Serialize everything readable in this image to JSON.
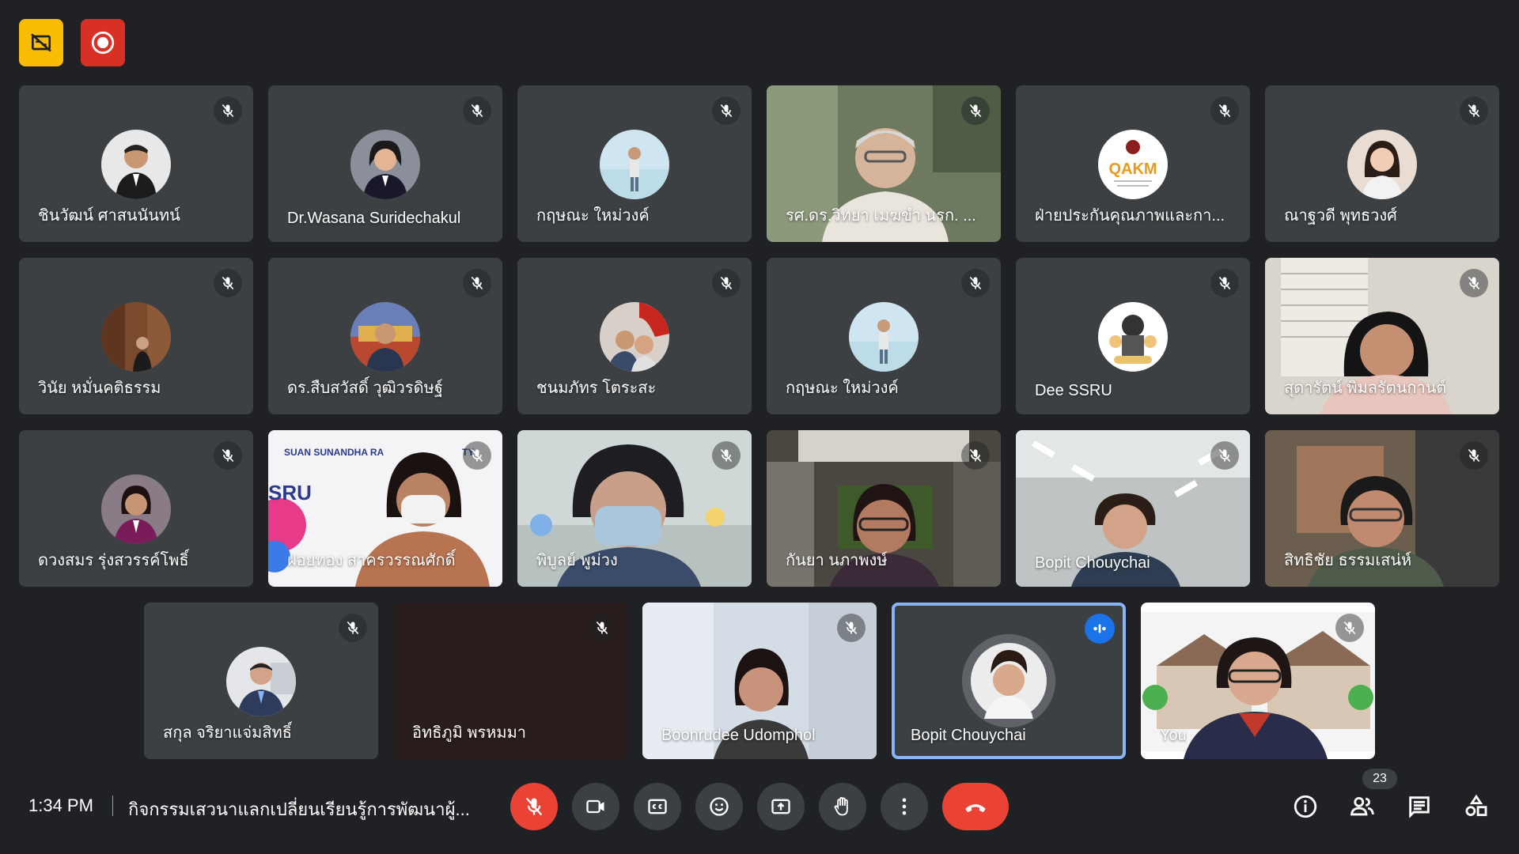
{
  "top_badges": {
    "captions_off_icon": "no-captions-icon",
    "record_icon": "recording-icon"
  },
  "participants": [
    {
      "name": "ชินวัฒน์ ศาสนนันทน์"
    },
    {
      "name": "Dr.Wasana Suridechakul"
    },
    {
      "name": "กฤษณะ ใหม่วงค์"
    },
    {
      "name": "รศ.ดร.วิทยา เมฆขำ นรก. ..."
    },
    {
      "name": "ฝ่ายประกันคุณภาพและกา..."
    },
    {
      "name": "ณาฐวดี พุทธวงศ์"
    },
    {
      "name": "วินัย หมั่นคติธรรม"
    },
    {
      "name": "ดร.สืบสวัสดิ์ วุฒิวรดิษฐ์"
    },
    {
      "name": "ชนมภัทร โตระสะ"
    },
    {
      "name": "กฤษณะ ใหม่วงค์"
    },
    {
      "name": "Dee SSRU"
    },
    {
      "name": "สุดารัตน์ พิมลรัตนกานต์"
    },
    {
      "name": "ดวงสมร รุ่งสวรรค์โพธิ์"
    },
    {
      "name": "ฝอยทอง สาครวรรณศักดิ์"
    },
    {
      "name": "พิบูลย์ พูม่วง"
    },
    {
      "name": "กันยา นภาพงษ์"
    },
    {
      "name": "Bopit Chouychai"
    },
    {
      "name": "สิทธิชัย ธรรมเสน่ห์"
    },
    {
      "name": "สกุล จริยาแจ่มสิทธิ์"
    },
    {
      "name": "อิทธิภูมิ พรหมมา"
    },
    {
      "name": "Boonrudee Udomphol"
    },
    {
      "name": "Bopit Chouychai"
    },
    {
      "name": "You"
    }
  ],
  "tile_labels": {
    "qakm_logo": "QAKM",
    "ssru_banner": "SUAN SUNANDHA RA",
    "ssru_big": "SRU",
    "ssru_right": "TY"
  },
  "bottom": {
    "time": "1:34 PM",
    "meeting_title": "กิจกรรมเสวนาแลกเปลี่ยนเรียนรู้การพัฒนาผู้...",
    "participant_count": "23"
  },
  "colors": {
    "background": "#202124",
    "tile": "#3c4043",
    "danger": "#ea4335",
    "speaking": "#8ab4f8",
    "accent": "#1a73e8"
  }
}
